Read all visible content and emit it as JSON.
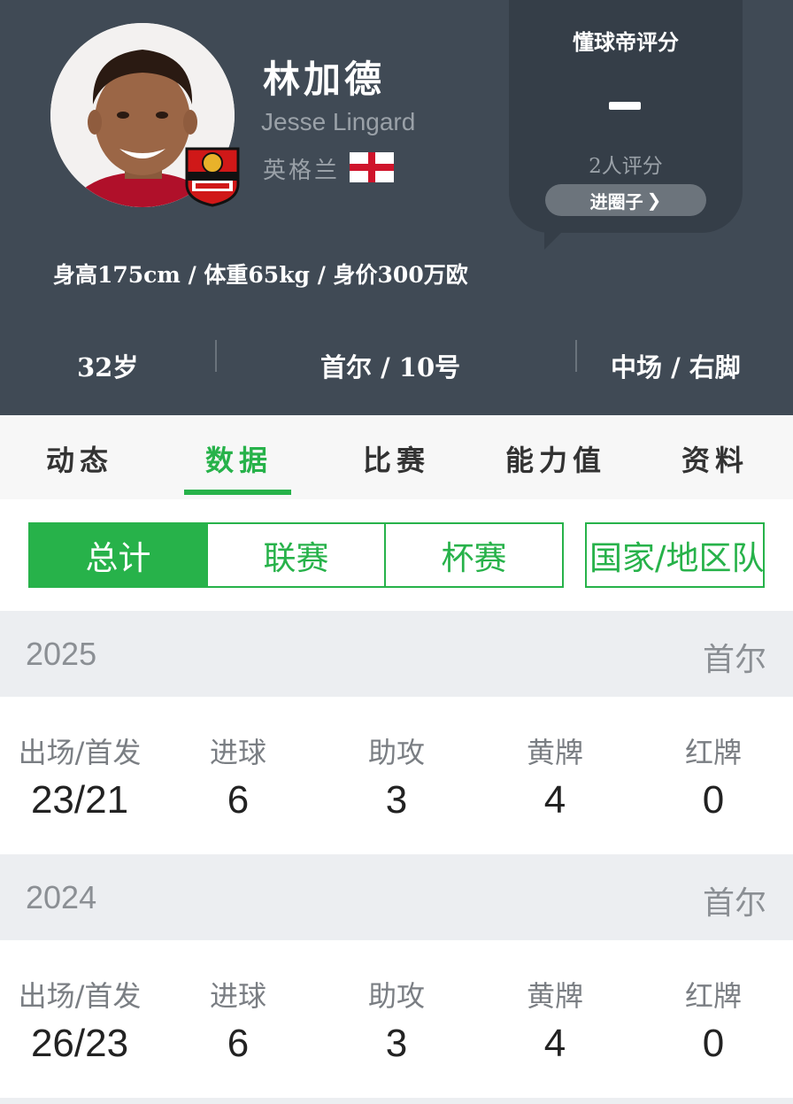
{
  "player": {
    "name_cn": "林加德",
    "name_en": "Jesse Lingard",
    "nation": "英格兰",
    "body_info": "身高175cm / 体重65kg / 身价300万欧"
  },
  "rating": {
    "title": "懂球帝评分",
    "count": "2人评分",
    "button": "进圈子"
  },
  "meta": {
    "age": "32岁",
    "club_number": "首尔 / 10号",
    "position_foot": "中场 / 右脚"
  },
  "tabs": [
    {
      "label": "动态",
      "active": false
    },
    {
      "label": "数据",
      "active": true
    },
    {
      "label": "比赛",
      "active": false
    },
    {
      "label": "能力值",
      "active": false
    },
    {
      "label": "资料",
      "active": false
    }
  ],
  "segments": [
    {
      "label": "总计",
      "active": true
    },
    {
      "label": "联赛",
      "active": false
    },
    {
      "label": "杯赛",
      "active": false
    },
    {
      "label": "国家/地区队",
      "active": false
    }
  ],
  "stat_labels": [
    "出场/首发",
    "进球",
    "助攻",
    "黄牌",
    "红牌"
  ],
  "seasons": [
    {
      "year": "2025",
      "team": "首尔",
      "values": [
        "23/21",
        "6",
        "3",
        "4",
        "0"
      ]
    },
    {
      "year": "2024",
      "team": "首尔",
      "values": [
        "26/23",
        "6",
        "3",
        "4",
        "0"
      ]
    }
  ],
  "colors": {
    "header_bg": "#404a55",
    "accent_green": "#27b24a",
    "season_bar": "#eceef1"
  }
}
